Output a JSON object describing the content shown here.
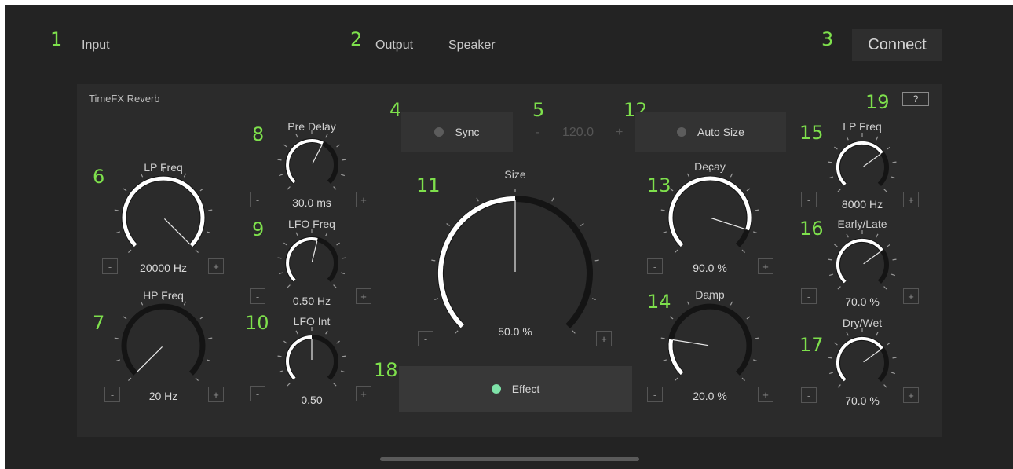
{
  "callouts": [
    "1",
    "2",
    "3",
    "4",
    "5",
    "6",
    "7",
    "8",
    "9",
    "10",
    "11",
    "12",
    "13",
    "14",
    "15",
    "16",
    "17",
    "18",
    "19"
  ],
  "header": {
    "input_label": "Input",
    "output_label": "Output",
    "device_label": "Speaker",
    "connect_label": "Connect"
  },
  "panel": {
    "title": "TimeFX Reverb",
    "help_label": "?",
    "sync_label": "Sync",
    "auto_size_label": "Auto Size",
    "effect_label": "Effect",
    "tempo": {
      "minus": "-",
      "value": "120.0",
      "plus": "+"
    },
    "step_minus": "-",
    "step_plus": "+"
  },
  "knobs": [
    {
      "id": "lp-freq-left",
      "label": "LP Freq",
      "value_text": "20000 Hz",
      "level": 1.0
    },
    {
      "id": "hp-freq",
      "label": "HP Freq",
      "value_text": "20 Hz",
      "level": 0.0
    },
    {
      "id": "pre-delay",
      "label": "Pre Delay",
      "value_text": "30.0 ms",
      "level": 0.6
    },
    {
      "id": "lfo-freq",
      "label": "LFO Freq",
      "value_text": "0.50 Hz",
      "level": 0.55
    },
    {
      "id": "lfo-int",
      "label": "LFO Int",
      "value_text": "0.50",
      "level": 0.5
    },
    {
      "id": "size",
      "label": "Size",
      "value_text": "50.0 %",
      "level": 0.5
    },
    {
      "id": "decay",
      "label": "Decay",
      "value_text": "90.0 %",
      "level": 0.9
    },
    {
      "id": "damp",
      "label": "Damp",
      "value_text": "20.0 %",
      "level": 0.2
    },
    {
      "id": "lp-freq-right",
      "label": "LP Freq",
      "value_text": "8000 Hz",
      "level": 0.7
    },
    {
      "id": "early-late",
      "label": "Early/Late",
      "value_text": "70.0 %",
      "level": 0.7
    },
    {
      "id": "dry-wet",
      "label": "Dry/Wet",
      "value_text": "70.0 %",
      "level": 0.7
    }
  ],
  "colors": {
    "accent_green": "#7ee04c",
    "led_on": "#7fe3a9",
    "knob_active": "#ffffff",
    "knob_track": "#141414"
  }
}
